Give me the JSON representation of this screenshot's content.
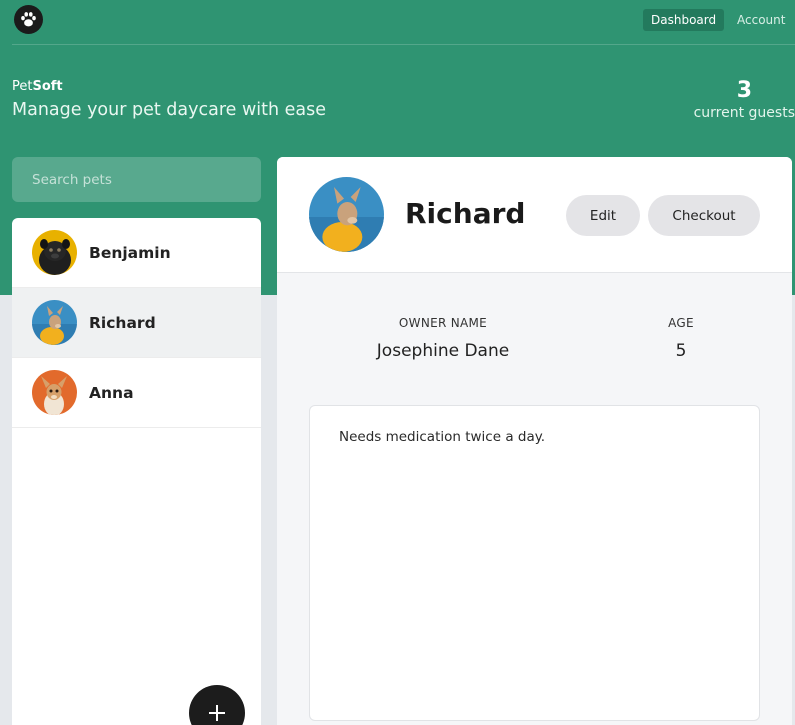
{
  "nav": {
    "logo_icon": "paw-icon",
    "links": [
      {
        "label": "Dashboard",
        "active": true
      },
      {
        "label": "Account",
        "active": false
      }
    ]
  },
  "header": {
    "brand_prefix": "Pet",
    "brand_suffix": "Soft",
    "tagline": "Manage your pet daycare with ease",
    "guest_count": "3",
    "guest_label": "current guests"
  },
  "search": {
    "placeholder": "Search pets",
    "value": ""
  },
  "pets": [
    {
      "name": "Benjamin",
      "selected": false,
      "avatar_color": "#e8b100"
    },
    {
      "name": "Richard",
      "selected": true,
      "avatar_color": "#3a8fc4"
    },
    {
      "name": "Anna",
      "selected": false,
      "avatar_color": "#e26a2c"
    }
  ],
  "add_button": {
    "icon": "plus-icon"
  },
  "detail": {
    "name": "Richard",
    "edit_label": "Edit",
    "checkout_label": "Checkout",
    "owner_label": "OWNER NAME",
    "owner_value": "Josephine Dane",
    "age_label": "AGE",
    "age_value": "5",
    "notes": "Needs medication twice a day."
  },
  "colors": {
    "brand_green": "#2f9472",
    "page_bg": "#e5e8ec",
    "button_gray": "#e4e4e7"
  }
}
